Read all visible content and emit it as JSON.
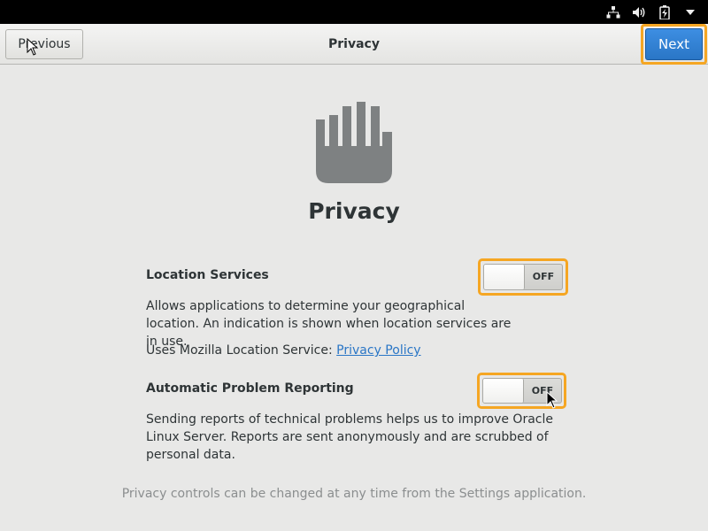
{
  "header": {
    "previous_label": "Previous",
    "title": "Privacy",
    "next_label": "Next"
  },
  "hero": {
    "icon": "hand-stop-icon",
    "title": "Privacy"
  },
  "location": {
    "label": "Location Services",
    "description": "Allows applications to determine your geographical location. An indication is shown when location services are in use.",
    "service_prefix": "Uses Mozilla Location Service: ",
    "policy_link": "Privacy Policy",
    "switch_state": "OFF"
  },
  "reporting": {
    "label": "Automatic Problem Reporting",
    "description": "Sending reports of technical problems helps us to improve Oracle Linux Server. Reports are sent anonymously and are scrubbed of personal data.",
    "switch_state": "OFF"
  },
  "footer": {
    "note": "Privacy controls can be changed at any time from the Settings application."
  },
  "tray": [
    "network-icon",
    "volume-icon",
    "battery-icon",
    "menu-arrow-icon"
  ],
  "colors": {
    "accent": "#2a76c6",
    "highlight": "#f5a623",
    "background": "#e8e8e7",
    "text": "#2e3436",
    "muted": "#8b8e8f"
  }
}
